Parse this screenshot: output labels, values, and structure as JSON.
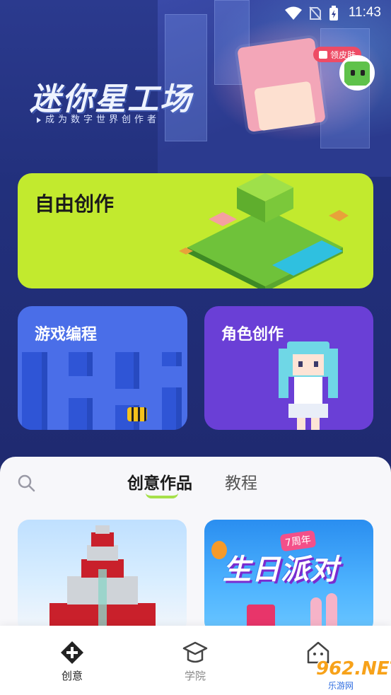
{
  "status_bar": {
    "time": "11:43",
    "icons": [
      "wifi-icon",
      "no-sim-icon",
      "battery-charging-icon"
    ]
  },
  "hero": {
    "title": "迷你星工场",
    "subtitle": "成为数字世界创作者",
    "skin_badge": "领皮肤"
  },
  "cards": {
    "free_create": "自由创作",
    "game_programming": "游戏编程",
    "character_create": "角色创作"
  },
  "sheet": {
    "tabs": [
      {
        "label": "创意作品",
        "active": true
      },
      {
        "label": "教程",
        "active": false
      }
    ],
    "thumb2_title": "生日派对",
    "thumb2_tag": "7周年"
  },
  "bottom_nav": [
    {
      "label": "创意",
      "icon": "create-icon",
      "active": true
    },
    {
      "label": "学院",
      "icon": "school-icon",
      "active": false
    },
    {
      "label": "",
      "icon": "home-icon",
      "active": false
    }
  ],
  "watermark": {
    "number": "962.NET",
    "site": "乐游网"
  },
  "colors": {
    "accent_green": "#c2ea2e",
    "card_blue": "#4a6ee8",
    "card_purple": "#6a3fd6",
    "badge_red": "#ee4b65"
  }
}
